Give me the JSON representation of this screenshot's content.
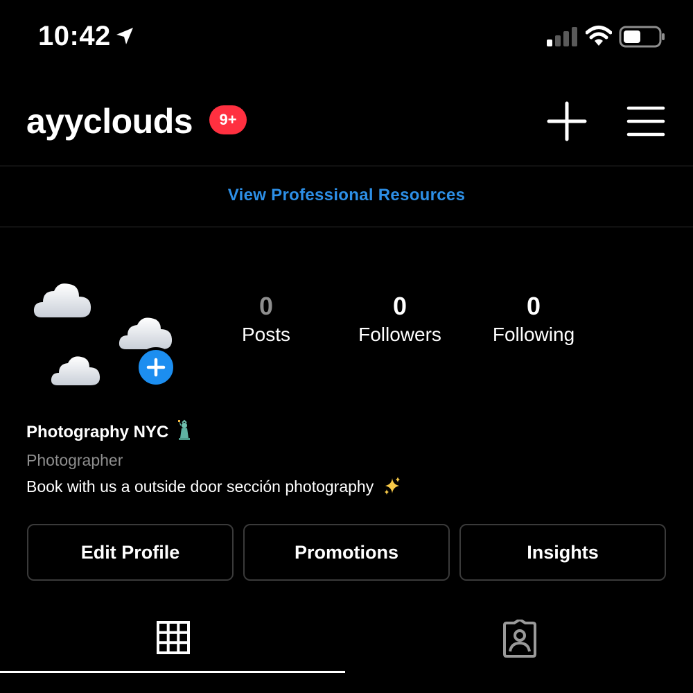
{
  "status_bar": {
    "time": "10:42",
    "icons": [
      "location-arrow-icon",
      "signal-icon",
      "wifi-icon",
      "battery-icon"
    ]
  },
  "header": {
    "username": "ayyclouds",
    "notification_badge": "9+",
    "badge_color": "#ff3040",
    "new_post_icon": "plus-icon",
    "menu_icon": "hamburger-menu-icon"
  },
  "pro_resources": {
    "label": "View Professional Resources",
    "color": "#2d8fe6"
  },
  "profile": {
    "avatar_icon": "cloud-emoji-avatar",
    "add_story_icon": "plus-circle-icon",
    "stats": [
      {
        "value": "0",
        "label": "Posts"
      },
      {
        "value": "0",
        "label": "Followers"
      },
      {
        "value": "0",
        "label": "Following"
      }
    ]
  },
  "bio": {
    "name": "Photography NYC",
    "name_emoji": "statue-of-liberty-icon",
    "category": "Photographer",
    "text": "Book with us a outside door sección photography",
    "text_emoji": "sparkles-icon"
  },
  "actions": {
    "edit_profile": "Edit Profile",
    "promotions": "Promotions",
    "insights": "Insights"
  },
  "tabs": {
    "active": "grid",
    "items": [
      "grid-icon",
      "tagged-person-icon"
    ]
  }
}
